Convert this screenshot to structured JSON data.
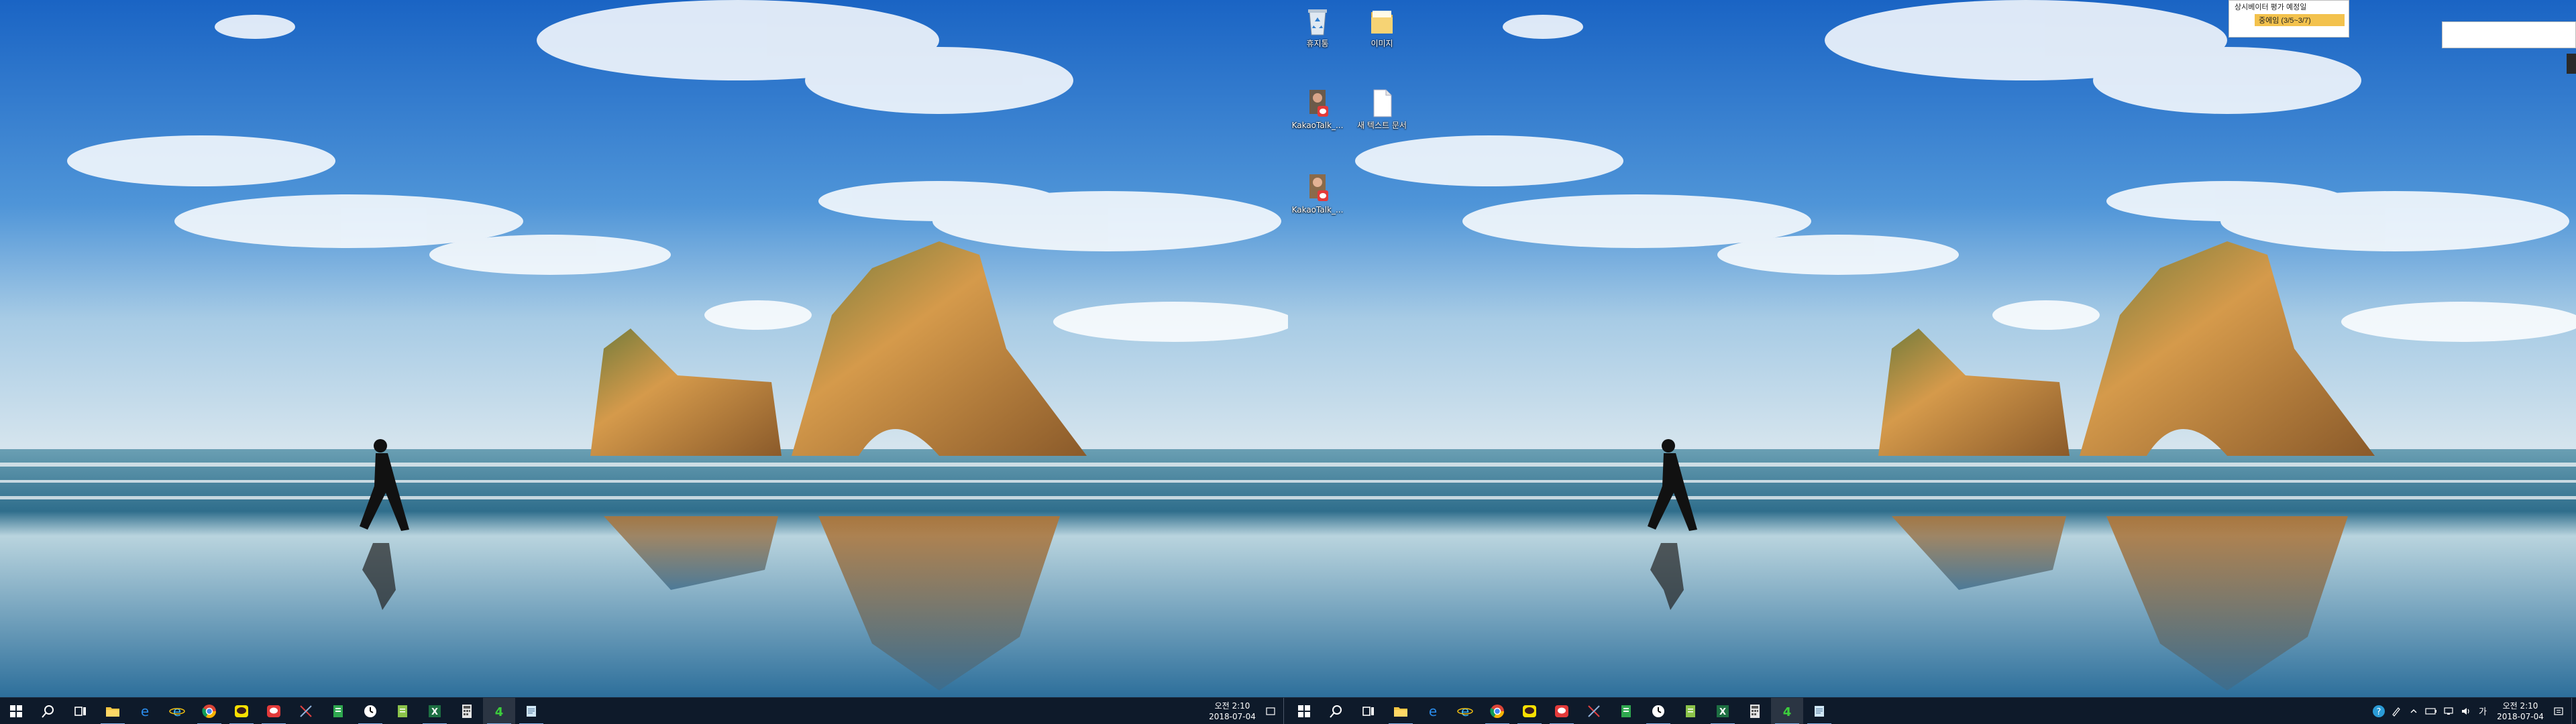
{
  "taskbar": {
    "clock": {
      "time": "오전 2:10",
      "date": "2018-07-04"
    },
    "ime_label": "가"
  },
  "left_taskbar_icons": [
    {
      "name": "start-icon"
    },
    {
      "name": "search-icon"
    },
    {
      "name": "task-view-icon"
    },
    {
      "name": "file-explorer-icon"
    },
    {
      "name": "edge-icon"
    },
    {
      "name": "internet-explorer-icon"
    },
    {
      "name": "chrome-icon"
    },
    {
      "name": "kakaotalk-icon"
    },
    {
      "name": "kakaotalk-red-icon"
    },
    {
      "name": "snipping-tool-icon"
    },
    {
      "name": "sheet-app-icon"
    },
    {
      "name": "clock-app-icon"
    },
    {
      "name": "document-app-icon"
    },
    {
      "name": "excel-icon"
    },
    {
      "name": "calculator-icon"
    },
    {
      "name": "hancom-icon"
    },
    {
      "name": "notepad-icon"
    }
  ],
  "desktop_icons": [
    {
      "label": "휴지통",
      "icon": "recycle-bin-icon"
    },
    {
      "label": "이미지",
      "icon": "folder-icon"
    },
    {
      "label": "KakaoTalk_...",
      "icon": "kakaotalk-image-icon"
    },
    {
      "label": "새 텍스트 문서",
      "icon": "text-document-icon"
    },
    {
      "label": "KakaoTalk_...",
      "icon": "kakaotalk-image-icon"
    }
  ],
  "floating_window": {
    "title": "상시베이터 평가 예정일",
    "highlight": "중에임 (3/5~3/7)"
  },
  "colors": {
    "taskbar": "#0e1a2a",
    "sky_top": "#1f6fcf",
    "sea": "#3b8fb4",
    "rock": "#c58a3a"
  }
}
